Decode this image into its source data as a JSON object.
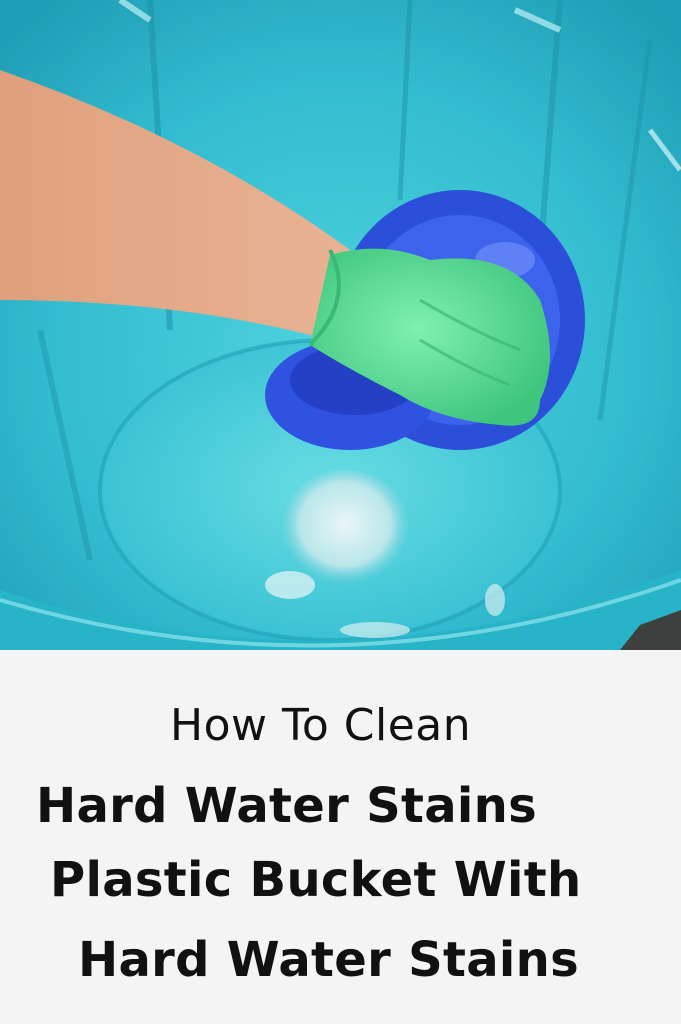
{
  "photo": {
    "subject": "gloved-hand-scrubbing-inside-plastic-bucket",
    "colors": {
      "bucket": "#36c0d3",
      "bucket_dark": "#1f98ae",
      "lid": "#2f54e0",
      "glove": "#5fe39a",
      "skin": "#e3a987"
    }
  },
  "caption": {
    "line1": "How To Clean",
    "line2": "Hard Water Stains",
    "line3": "Plastic Bucket With",
    "line4": "Hard Water Stains"
  }
}
